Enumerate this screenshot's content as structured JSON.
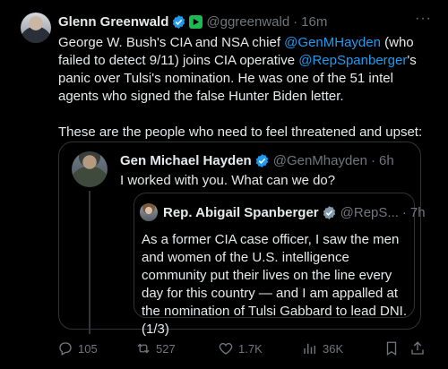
{
  "tweet": {
    "name": "Glenn Greenwald",
    "handle": "@ggreenwald",
    "separator": "·",
    "time": "16m",
    "more": "···",
    "body": {
      "t1": "George W. Bush's CIA and NSA chief ",
      "mention1": "@GenMHayden",
      "t2": " (who failed to detect 9/11) joins CIA operative ",
      "mention2": "@RepSpanberger",
      "t3": "'s panic over Tulsi's nomination. He was one of the 51 intel agents who signed the false Hunter Biden letter.",
      "p2": "These are the people who need to feel threatened and upset:"
    }
  },
  "quote1": {
    "name": "Gen Michael Hayden",
    "handle": "@GenMhayden",
    "separator": "·",
    "time": "6h",
    "text": "I worked with you. What can we do?"
  },
  "quote2": {
    "name": "Rep. Abigail Spanberger",
    "handle": "@RepS...",
    "separator": "·",
    "time": "7h",
    "text": "As a former CIA case officer, I saw the men and women of the U.S. intelligence community put their lives on the line every day for this country — and I am appalled at the nomination of Tulsi Gabbard to lead DNI. (1/3)"
  },
  "actions": {
    "replies": "105",
    "reposts": "527",
    "likes": "1.7K",
    "views": "36K"
  },
  "colors": {
    "background": "#000000",
    "text": "#e7e9ea",
    "muted": "#71767b",
    "link": "#1d9bf0",
    "border": "#2f3336",
    "verified_blue": "#1d9bf0",
    "verified_gray": "#829aab"
  },
  "icons": [
    "more-icon",
    "verified-icon",
    "app-badge-icon",
    "reply-icon",
    "repost-icon",
    "like-icon",
    "views-icon",
    "bookmark-icon",
    "share-icon"
  ]
}
